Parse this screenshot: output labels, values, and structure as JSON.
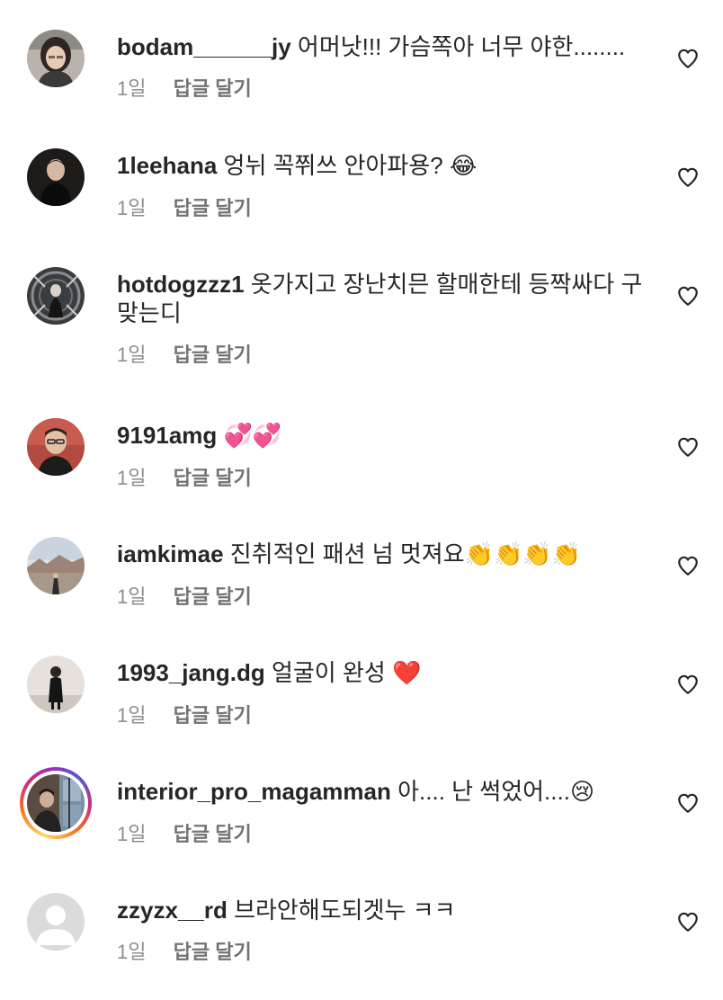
{
  "comments": [
    {
      "username": "bodam______jy",
      "text": "어머낫!!! 가슴쪽아 너무 야한........",
      "emoji": "",
      "age": "1일",
      "reply": "답글 달기",
      "avatar_icon": "profile-photo-icon"
    },
    {
      "username": "1leehana",
      "text": "엉뉘 꼭쮜쓰 안아파용?",
      "emoji": "😂",
      "age": "1일",
      "reply": "답글 달기",
      "avatar_icon": "profile-photo-icon"
    },
    {
      "username": "hotdogzzz1",
      "text": "옷가지고 장난치믄 할매한테 등짝싸다 구 맞는디",
      "emoji": "",
      "age": "1일",
      "reply": "답글 달기",
      "avatar_icon": "profile-photo-icon"
    },
    {
      "username": "9191amg",
      "text": "",
      "emoji": "💞💞",
      "age": "1일",
      "reply": "답글 달기",
      "avatar_icon": "profile-photo-icon"
    },
    {
      "username": "iamkimae",
      "text": "진취적인 패션 넘 멋져요",
      "emoji": "👏👏👏👏",
      "age": "1일",
      "reply": "답글 달기",
      "avatar_icon": "profile-photo-icon"
    },
    {
      "username": "1993_jang.dg",
      "text": "얼굴이 완성",
      "emoji": "❤️",
      "age": "1일",
      "reply": "답글 달기",
      "avatar_icon": "profile-photo-icon"
    },
    {
      "username": "interior_pro_magamman",
      "text": "아.... 난 썩었어....",
      "emoji": "😢",
      "age": "1일",
      "reply": "답글 달기",
      "avatar_icon": "profile-photo-icon",
      "has_story_ring": true
    },
    {
      "username": "zzyzx__rd",
      "text": "브라안해도되겟누 ㅋㅋ",
      "emoji": "",
      "age": "1일",
      "reply": "답글 달기",
      "avatar_icon": "default-profile-icon"
    }
  ],
  "icons": {
    "like": "heart-outline-icon"
  },
  "colors": {
    "text": "#262626",
    "secondary": "#8e8e8e",
    "story_ring_start": "#feda75",
    "story_ring_end": "#d62976"
  }
}
